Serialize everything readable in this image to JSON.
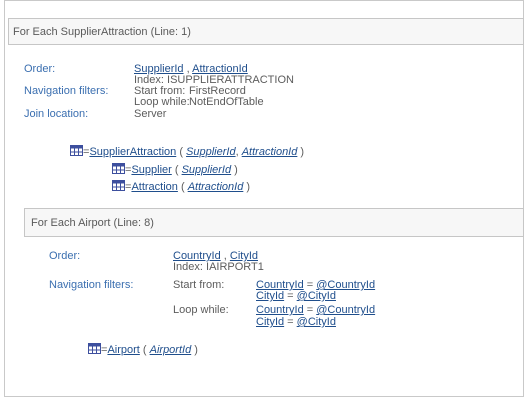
{
  "block1": {
    "header": "For Each SupplierAttraction (Line: 1)",
    "order_label": "Order:",
    "order_fields": [
      "SupplierId",
      "AttractionId"
    ],
    "order_sep": " , ",
    "index": "Index: ISUPPLIERATTRACTION",
    "nav_label": "Navigation filters:",
    "start_from_label": "Start from:",
    "start_from_value": "FirstRecord",
    "loop_while_label": "Loop while:",
    "loop_while_value": "NotEndOfTable",
    "join_label": "Join location:",
    "join_value": "Server",
    "tree": {
      "root": {
        "prefix": "=",
        "name": "SupplierAttraction",
        "open": " ( ",
        "params": [
          "SupplierId",
          "AttractionId"
        ],
        "sep": ",  ",
        "close": " )"
      },
      "children": [
        {
          "prefix": "=",
          "name": "Supplier",
          "open": " ( ",
          "param": "SupplierId",
          "close": " )"
        },
        {
          "prefix": "=",
          "name": "Attraction",
          "open": " ( ",
          "param": "AttractionId",
          "close": " )"
        }
      ]
    }
  },
  "block2": {
    "header": "For Each Airport (Line: 8)",
    "order_label": "Order:",
    "order_fields": [
      "CountryId",
      "CityId"
    ],
    "order_sep": " , ",
    "index": "Index: IAIRPORT1",
    "nav_label": "Navigation filters:",
    "start_from_label": "Start from:",
    "loop_while_label": "Loop while:",
    "start_conditions": [
      {
        "field": "CountryId",
        "op": " = ",
        "var": "@CountryId"
      },
      {
        "field": "CityId",
        "op": " = ",
        "var": "@CityId"
      }
    ],
    "loop_conditions": [
      {
        "field": "CountryId",
        "op": " = ",
        "var": "@CountryId"
      },
      {
        "field": "CityId",
        "op": " = ",
        "var": "@CityId"
      }
    ],
    "tree": {
      "root": {
        "prefix": "=",
        "name": "Airport",
        "open": " ( ",
        "param": "AirportId",
        "close": " )"
      }
    }
  },
  "icons": {
    "table": "table-icon"
  },
  "colors": {
    "label": "#3b6fb0",
    "link": "#1f4e8c",
    "text": "#5c5c5c",
    "header_bg": "#f7f7f7",
    "icon": "#3d4f9e"
  }
}
